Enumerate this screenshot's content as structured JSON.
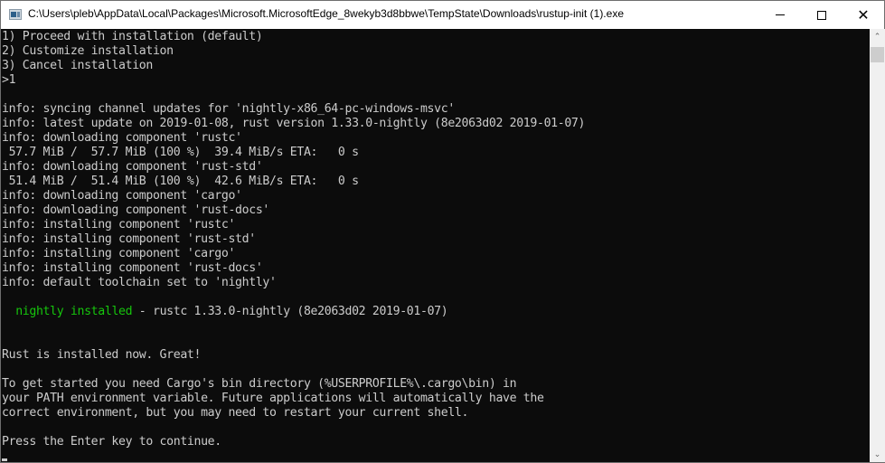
{
  "window": {
    "title": "C:\\Users\\pleb\\AppData\\Local\\Packages\\Microsoft.MicrosoftEdge_8wekyb3d8bbwe\\TempState\\Downloads\\rustup-init (1).exe",
    "icons": {
      "app": "console-app-icon",
      "minimize": "minimize-icon",
      "maximize": "maximize-icon",
      "close": "close-icon"
    },
    "close_glyph": "✕"
  },
  "console": {
    "lines": [
      {
        "text": "1) Proceed with installation (default)"
      },
      {
        "text": "2) Customize installation"
      },
      {
        "text": "3) Cancel installation"
      },
      {
        "text": ">1"
      },
      {
        "text": ""
      },
      {
        "text": "info: syncing channel updates for 'nightly-x86_64-pc-windows-msvc'"
      },
      {
        "text": "info: latest update on 2019-01-08, rust version 1.33.0-nightly (8e2063d02 2019-01-07)"
      },
      {
        "text": "info: downloading component 'rustc'"
      },
      {
        "text": " 57.7 MiB /  57.7 MiB (100 %)  39.4 MiB/s ETA:   0 s"
      },
      {
        "text": "info: downloading component 'rust-std'"
      },
      {
        "text": " 51.4 MiB /  51.4 MiB (100 %)  42.6 MiB/s ETA:   0 s"
      },
      {
        "text": "info: downloading component 'cargo'"
      },
      {
        "text": "info: downloading component 'rust-docs'"
      },
      {
        "text": "info: installing component 'rustc'"
      },
      {
        "text": "info: installing component 'rust-std'"
      },
      {
        "text": "info: installing component 'cargo'"
      },
      {
        "text": "info: installing component 'rust-docs'"
      },
      {
        "text": "info: default toolchain set to 'nightly'"
      },
      {
        "text": ""
      },
      {
        "prefix": "  ",
        "highlight": "nightly installed",
        "text": " - rustc 1.33.0-nightly (8e2063d02 2019-01-07)"
      },
      {
        "text": ""
      },
      {
        "text": ""
      },
      {
        "text": "Rust is installed now. Great!"
      },
      {
        "text": ""
      },
      {
        "text": "To get started you need Cargo's bin directory (%USERPROFILE%\\.cargo\\bin) in"
      },
      {
        "text": "your PATH environment variable. Future applications will automatically have the"
      },
      {
        "text": "correct environment, but you may need to restart your current shell."
      },
      {
        "text": ""
      },
      {
        "text": "Press the Enter key to continue."
      }
    ],
    "colors": {
      "background": "#0c0c0c",
      "foreground": "#cccccc",
      "highlight": "#16c60c"
    }
  },
  "scrollbar": {
    "up_glyph": "⌃",
    "down_glyph": "⌄",
    "position": 0.0
  }
}
